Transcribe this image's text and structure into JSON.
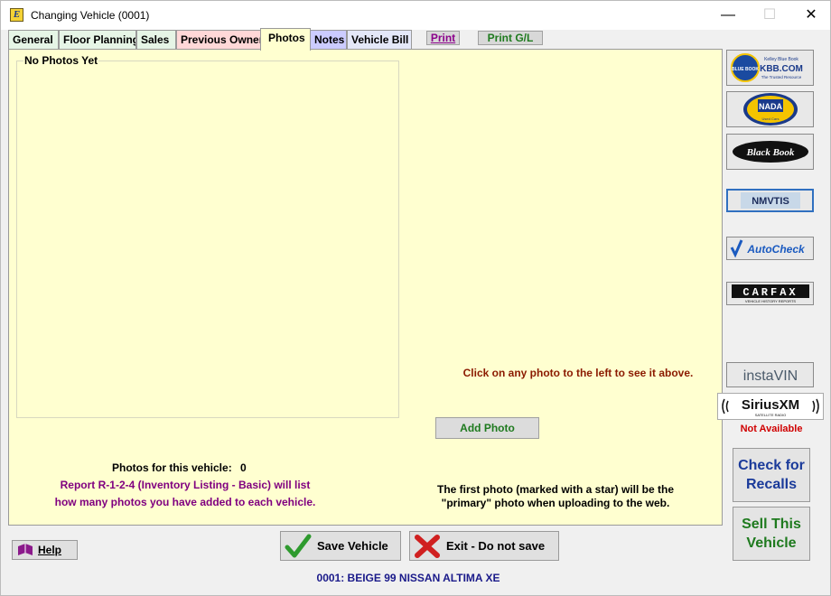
{
  "window": {
    "title": "Changing Vehicle  (0001)",
    "app_icon_letter": "E",
    "minimize": "—",
    "maximize": "☐",
    "close": "✕"
  },
  "tabs": [
    {
      "label": "General",
      "bg": "#e6f5e6",
      "color": "#000000"
    },
    {
      "label": "Floor Planning",
      "bg": "#e6f5e6",
      "color": "#000000"
    },
    {
      "label": "Sales",
      "bg": "#e6f5e6",
      "color": "#000000"
    },
    {
      "label": "Previous Owner",
      "bg": "#ffd8d8",
      "color": "#000000"
    },
    {
      "label": "Photos",
      "bg": "#ffffd0",
      "color": "#000000"
    },
    {
      "label": "Notes",
      "bg": "#ccccff",
      "color": "#000000"
    },
    {
      "label": "Vehicle Bill",
      "bg": "#e4e8f8",
      "color": "#000000"
    }
  ],
  "toolbar": {
    "print_label": "Print",
    "print_gl_label": "Print G/L",
    "print_color": "#8b008b",
    "print_gl_color": "#1e7a1e"
  },
  "photos": {
    "group_label": "No Photos Yet",
    "click_hint": "Click on any photo to the left to see it above.",
    "add_photo_label": "Add Photo",
    "count_label": "Photos for this vehicle:",
    "count_value": "0",
    "report_line1": "Report R-1-2-4 (Inventory Listing - Basic) will list",
    "report_line2": "how many photos you have added to each vehicle.",
    "primary_line1": "The first photo (marked with a star) will be the",
    "primary_line2": "\"primary\" photo when uploading to the web."
  },
  "sidebar": {
    "kbb_top": "Kelley Blue Book",
    "kbb_main": "KBB.COM",
    "kbb_sub": "The Trusted Resource",
    "kbb_seal": "BLUE BOOK",
    "nada": "NADA",
    "nada_sub": "Used Cars",
    "blackbook": "Black Book",
    "nmvtis": "NMVTIS",
    "autocheck": "AutoCheck",
    "carfax": "CARFAX",
    "carfax_sub": "VEHICLE HISTORY REPORTS",
    "instavin": "instaVIN",
    "siriusxm": "SiriusXM",
    "siriusxm_sub": "SATELLITE RADIO",
    "not_available": "Not Available",
    "recalls_label": "Check for Recalls",
    "sell_label": "Sell This Vehicle"
  },
  "footer": {
    "help_label": "Help",
    "save_label": "Save Vehicle",
    "exit_label": "Exit - Do not save",
    "vehicle_desc": "0001: BEIGE 99 NISSAN ALTIMA XE"
  },
  "colors": {
    "panel_bg": "#ffffd0",
    "hint_red": "#8b1a00",
    "report_purple": "#800080",
    "recalls_blue": "#1a3a9a",
    "sell_green": "#1e7a1e",
    "not_available_red": "#d00000"
  }
}
